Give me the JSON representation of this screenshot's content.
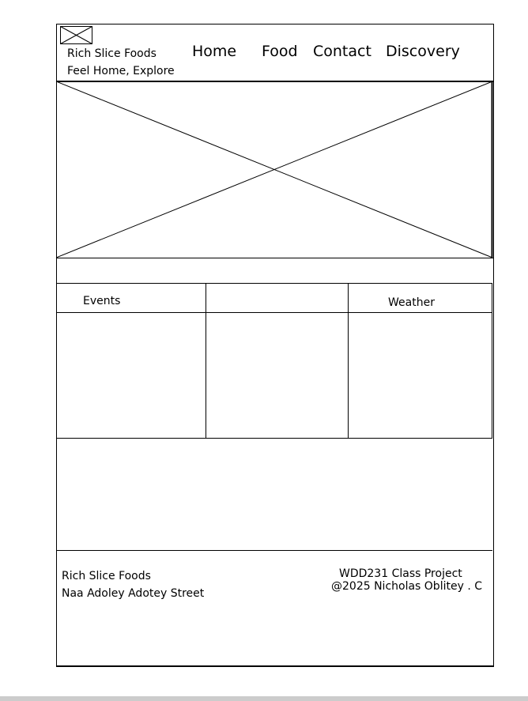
{
  "header": {
    "logo_icon": "image-placeholder-icon",
    "brand_name": "Rich Slice Foods",
    "tagline": "Feel Home, Explore",
    "nav": [
      {
        "label": "Home"
      },
      {
        "label": "Food"
      },
      {
        "label": "Contact"
      },
      {
        "label": "Discovery"
      }
    ]
  },
  "hero": {
    "icon": "image-placeholder-icon"
  },
  "sections": {
    "events_label": "Events",
    "weather_label": "Weather"
  },
  "footer": {
    "company": "Rich Slice Foods",
    "address": "Naa Adoley Adotey Street",
    "project": "WDD231 Class Project",
    "copyright": "@2025 Nicholas Oblitey . C"
  }
}
